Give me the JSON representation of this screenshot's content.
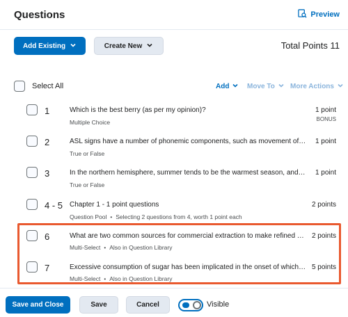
{
  "header": {
    "title": "Questions",
    "preview_label": "Preview"
  },
  "toolbar": {
    "add_existing_label": "Add Existing",
    "create_new_label": "Create New",
    "total_points": "Total Points 11"
  },
  "list_actions": {
    "select_all_label": "Select All",
    "add_label": "Add",
    "move_to_label": "Move To",
    "more_actions_label": "More Actions"
  },
  "questions": [
    {
      "number": "1",
      "text": "Which is the best berry (as per my opinion)?",
      "type": "Multiple Choice",
      "points": "1 point",
      "bonus": "BONUS"
    },
    {
      "number": "2",
      "text": "ASL signs have a number of phonemic components, such as movement of the...",
      "type": "True or False",
      "points": "1 point"
    },
    {
      "number": "3",
      "text": "In the northern hemisphere, summer tends to be the warmest season, and u...",
      "type": "True or False",
      "points": "1 point"
    },
    {
      "number": "4 - 5",
      "text": "Chapter 1 - 1 point questions",
      "type": "Question Pool",
      "extra": "Selecting 2 questions from 4, worth 1 point each",
      "points": "2 points"
    },
    {
      "number": "6",
      "text": "What are two common sources for commercial extraction to make refined s...",
      "type": "Multi-Select",
      "extra": "Also in Question Library",
      "points": "2 points"
    },
    {
      "number": "7",
      "text": "Excessive consumption of sugar has been implicated in the onset of which h...",
      "type": "Multi-Select",
      "extra": "Also in Question Library",
      "points": "5 points"
    }
  ],
  "footer": {
    "save_close_label": "Save and Close",
    "save_label": "Save",
    "cancel_label": "Cancel",
    "visible_label": "Visible"
  },
  "colors": {
    "accent": "#006fbf",
    "highlight": "#e9592f"
  }
}
